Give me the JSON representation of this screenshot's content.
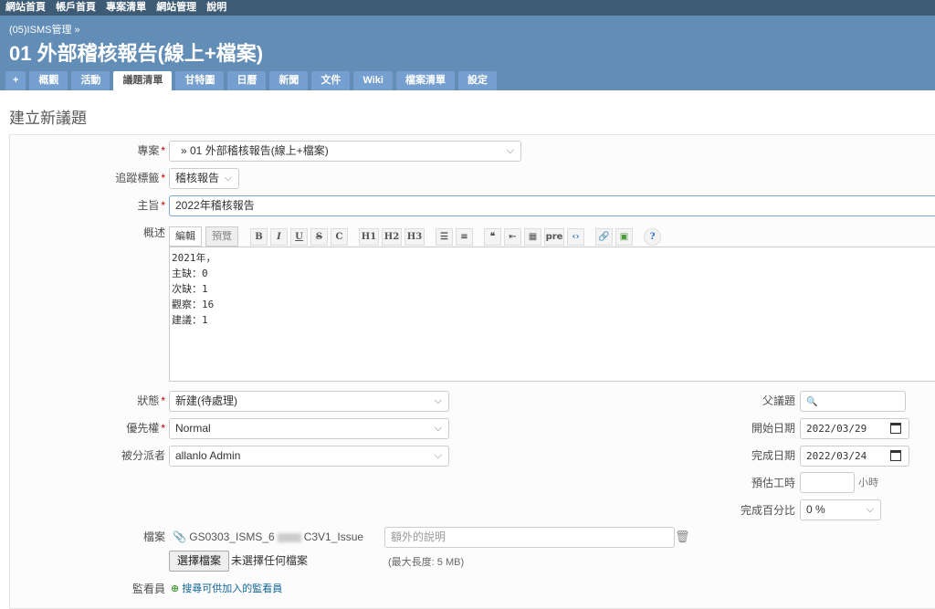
{
  "top_menu": [
    "網站首頁",
    "帳戶首頁",
    "專案清單",
    "網站管理",
    "說明"
  ],
  "header": {
    "breadcrumb": "(05)ISMS管理 »",
    "title": "01 外部稽核報告(線上+檔案)"
  },
  "tabs": [
    {
      "label": "+"
    },
    {
      "label": "概觀"
    },
    {
      "label": "活動"
    },
    {
      "label": "議題清單"
    },
    {
      "label": "甘特圖"
    },
    {
      "label": "日曆"
    },
    {
      "label": "新聞"
    },
    {
      "label": "文件"
    },
    {
      "label": "Wiki"
    },
    {
      "label": "檔案清單"
    },
    {
      "label": "設定"
    }
  ],
  "page_heading": "建立新議題",
  "form": {
    "project": {
      "label": "專案",
      "required": "*",
      "value": "» 01 外部稽核報告(線上+檔案)"
    },
    "tracker": {
      "label": "追蹤標籤",
      "required": "*",
      "value": "稽核報告"
    },
    "subject": {
      "label": "主旨",
      "required": "*",
      "value": "2022年稽核報告"
    },
    "description": {
      "label": "概述",
      "tab_edit": "編輯",
      "tab_preview": "預覽",
      "toolbar": [
        "B",
        "I",
        "U",
        "S",
        "C",
        "H1",
        "H2",
        "H3",
        "pre"
      ],
      "lines": [
        "2021年，",
        "主缺：0",
        "次缺：1",
        "觀察：16",
        "建議：1"
      ]
    },
    "status": {
      "label": "狀態",
      "required": "*",
      "value": "新建(待處理)"
    },
    "priority": {
      "label": "優先權",
      "required": "*",
      "value": "Normal"
    },
    "assignee": {
      "label": "被分派者",
      "value": "allanlo Admin"
    },
    "parent": {
      "label": "父議題"
    },
    "start_date": {
      "label": "開始日期",
      "value": "2022/03/29"
    },
    "due_date": {
      "label": "完成日期",
      "value": "2022/03/24"
    },
    "estimated": {
      "label": "預估工時",
      "unit": "小時"
    },
    "done_ratio": {
      "label": "完成百分比",
      "value": "0 %"
    },
    "files": {
      "label": "檔案",
      "filename": "GS0303_ISMS_6",
      "filename_tail": "C3V1_Issue",
      "desc_placeholder": "額外的說明",
      "choose_button": "選擇檔案",
      "no_file": "未選擇任何檔案",
      "max_size": "(最大長度: 5 MB)"
    },
    "watchers": {
      "label": "監看員",
      "search_link": "搜尋可供加入的監看員"
    }
  },
  "colors": {
    "top_menu": "#3e5b76",
    "header": "#628db6",
    "tab": "#759fcf",
    "required": "#bb0000",
    "link": "#116699"
  }
}
